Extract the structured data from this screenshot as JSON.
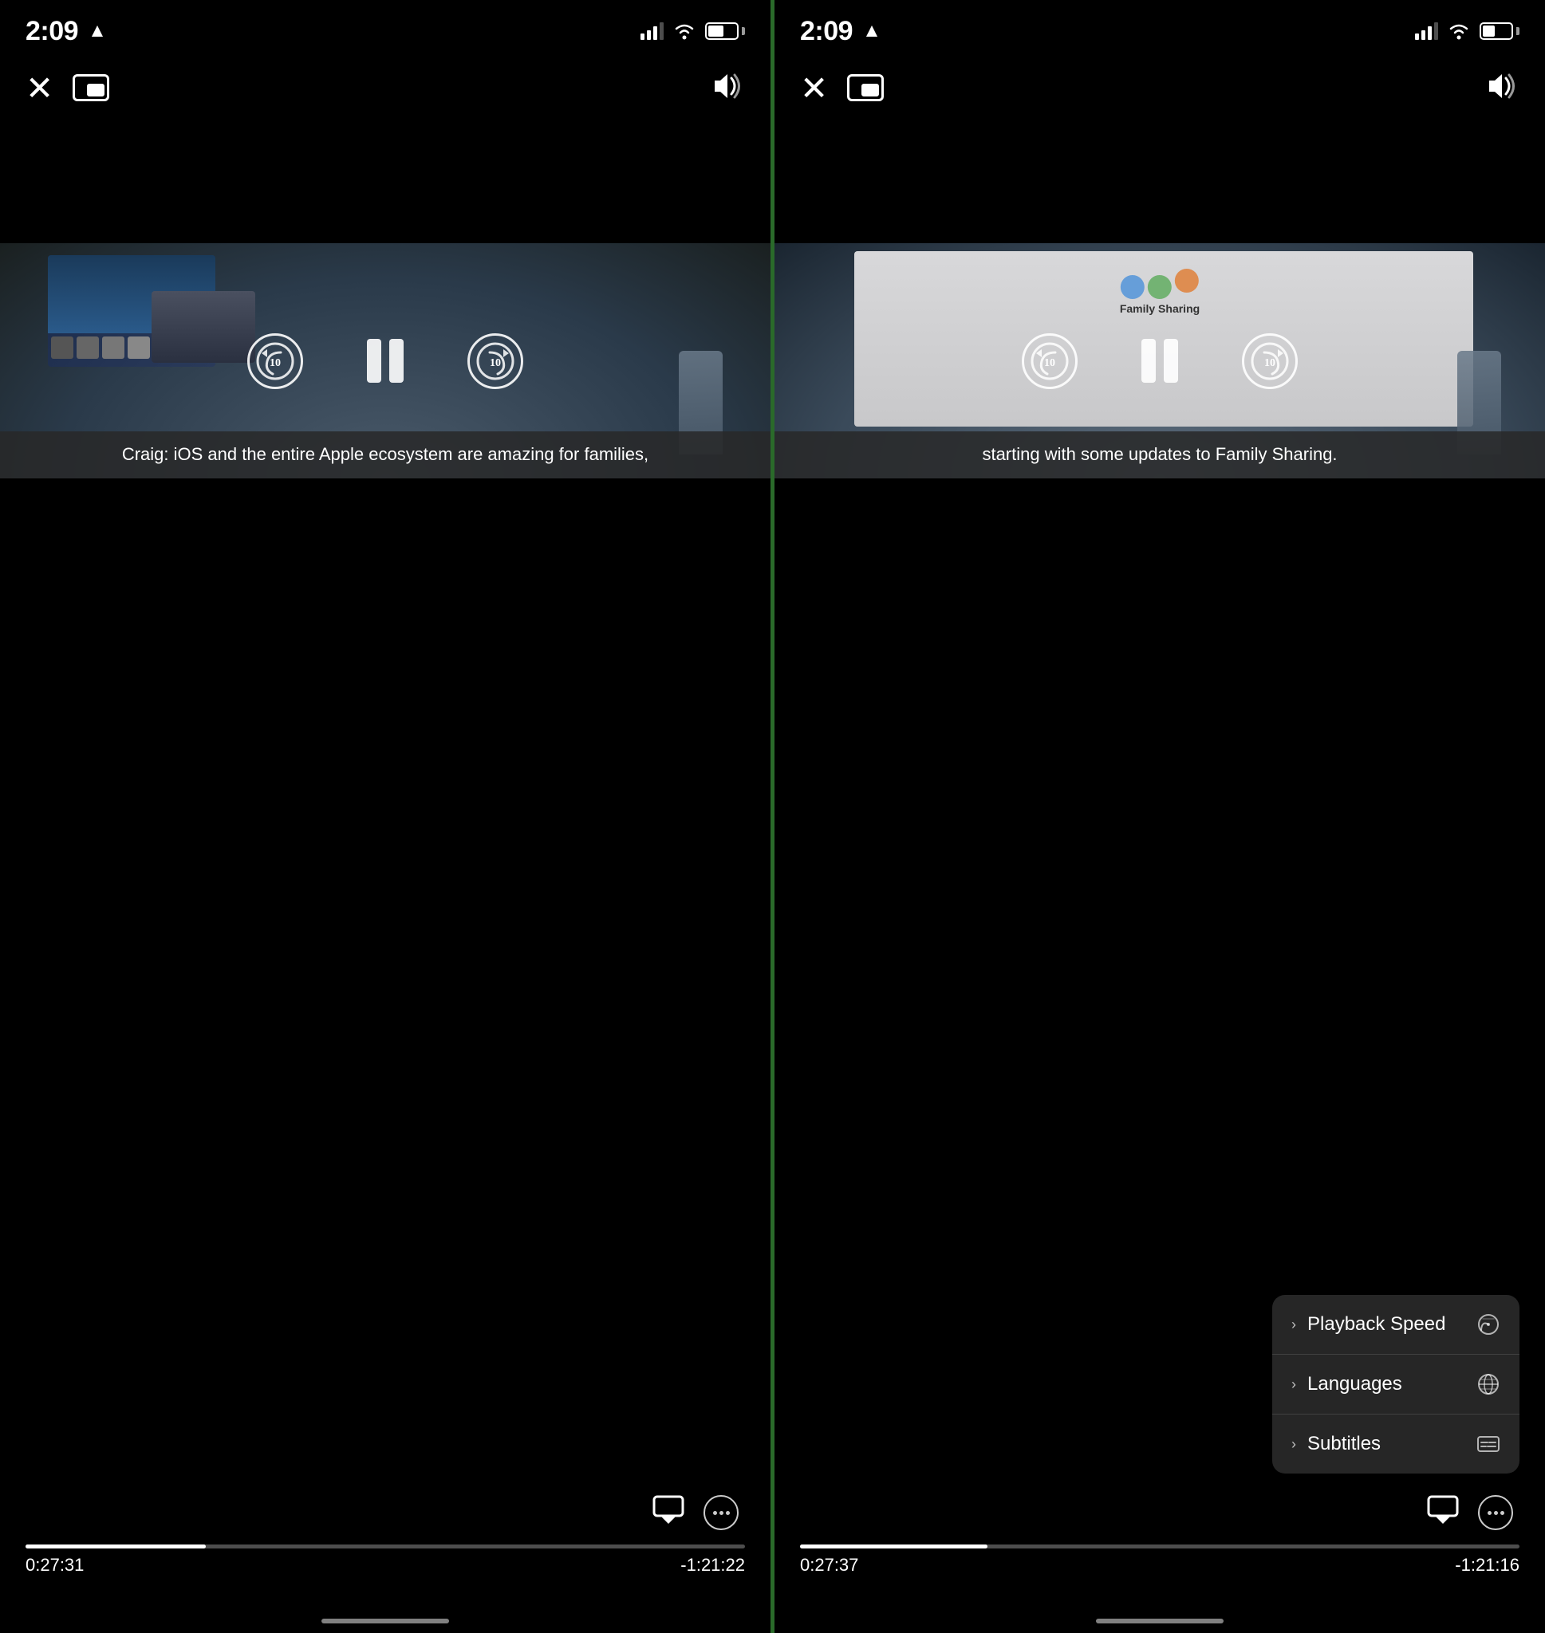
{
  "left_panel": {
    "status": {
      "time": "2:09",
      "location_arrow": "▲"
    },
    "controls": {
      "close_label": "✕",
      "pip_label": "pip",
      "volume_label": "🔊"
    },
    "subtitle": "Craig: iOS and the entire Apple ecosystem\nare amazing for families,",
    "skip_back_label": "10",
    "skip_forward_label": "10",
    "time_current": "0:27:31",
    "time_remaining": "-1:21:22",
    "progress_percent": 25
  },
  "right_panel": {
    "status": {
      "time": "2:09",
      "location_arrow": "▲"
    },
    "controls": {
      "close_label": "✕",
      "pip_label": "pip",
      "volume_label": "🔊"
    },
    "subtitle": "starting with some updates\nto Family Sharing.",
    "skip_back_label": "10",
    "skip_forward_label": "10",
    "time_current": "0:27:37",
    "time_remaining": "-1:21:16",
    "progress_percent": 26,
    "menu": {
      "items": [
        {
          "label": "Playback Speed",
          "icon": "⏱"
        },
        {
          "label": "Languages",
          "icon": "🌐"
        },
        {
          "label": "Subtitles",
          "icon": "💬"
        }
      ]
    }
  }
}
